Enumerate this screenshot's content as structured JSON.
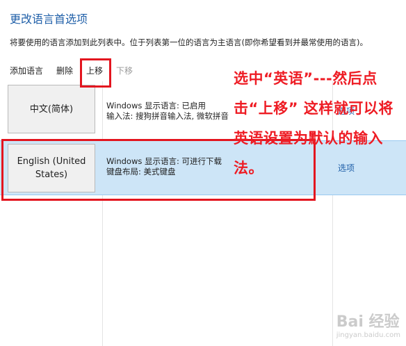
{
  "header": {
    "title": "更改语言首选项",
    "description": "将要使用的语言添加到此列表中。位于列表第一位的语言为主语言(即你希望看到并最常使用的语言)。"
  },
  "toolbar": {
    "add": "添加语言",
    "remove": "删除",
    "move_up": "上移",
    "move_down": "下移"
  },
  "languages": [
    {
      "name": "中文(简体)",
      "display_language": "Windows 显示语言: 已启用",
      "input": "输入法: 搜狗拼音输入法, 微软拼音",
      "options": "选项"
    },
    {
      "name": "English (United States)",
      "display_language": "Windows 显示语言: 可进行下载",
      "input": "键盘布局: 美式键盘",
      "options": "选项"
    }
  ],
  "annotation": "选中“英语”---然后点击“上移”    这样就可以将英语设置为默认的输入法。",
  "watermark": {
    "brand": "Bai 经验",
    "url": "jingyan.baidu.com"
  },
  "colors": {
    "title": "#1f5fa8",
    "selection": "#cde5f7",
    "annotation": "#ee1c24"
  }
}
